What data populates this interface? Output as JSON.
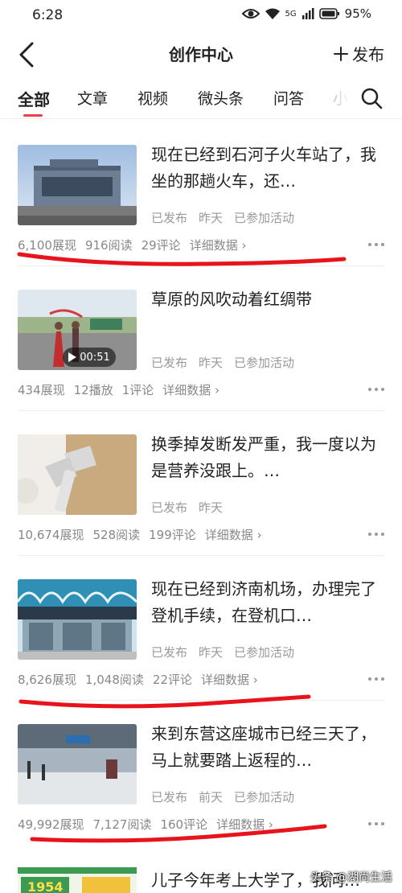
{
  "status_bar": {
    "time": "6:28",
    "signal_label": "5G",
    "battery": "95%"
  },
  "header": {
    "title": "创作中心",
    "publish_label": "发布"
  },
  "tabs": [
    {
      "label": "全部",
      "active": true
    },
    {
      "label": "文章",
      "active": false
    },
    {
      "label": "视频",
      "active": false
    },
    {
      "label": "微头条",
      "active": false
    },
    {
      "label": "问答",
      "active": false
    },
    {
      "label": "小",
      "active": false
    }
  ],
  "items": [
    {
      "title": "现在已经到石河子火车站了，我坐的那趟火车，还…",
      "meta": [
        "已发布",
        "昨天",
        "已参加活动"
      ],
      "stats": [
        "6,100展现",
        "916阅读",
        "29评论"
      ],
      "detail_label": "详细数据",
      "thumb_kind": "station",
      "highlighted": true
    },
    {
      "title": "草原的风吹动着红绸带",
      "meta": [
        "已发布",
        "昨天",
        "已参加活动"
      ],
      "stats": [
        "434展现",
        "12播放",
        "1评论"
      ],
      "detail_label": "详细数据",
      "thumb_kind": "video",
      "video_duration": "00:51",
      "highlighted": false
    },
    {
      "title": "换季掉发断发严重，我一度以为是营养没跟上。…",
      "meta": [
        "已发布",
        "昨天"
      ],
      "stats": [
        "10,674展现",
        "528阅读",
        "199评论"
      ],
      "detail_label": "详细数据",
      "thumb_kind": "dryer",
      "highlighted": false
    },
    {
      "title": "现在已经到济南机场，办理完了登机手续，在登机口…",
      "meta": [
        "已发布",
        "昨天",
        "已参加活动"
      ],
      "stats": [
        "8,626展现",
        "1,048阅读",
        "22评论"
      ],
      "detail_label": "详细数据",
      "thumb_kind": "airport",
      "highlighted": true
    },
    {
      "title": "来到东营这座城市已经三天了，马上就要踏上返程的…",
      "meta": [
        "已发布",
        "前天",
        "已参加活动"
      ],
      "stats": [
        "49,992展现",
        "7,127阅读",
        "160评论"
      ],
      "detail_label": "详细数据",
      "thumb_kind": "hall",
      "highlighted": true
    }
  ],
  "last_item": {
    "title": "儿子今年考上大学了，我问…",
    "thumb_text": "1954"
  },
  "watermark": "头条 @湖尚生活",
  "colors": {
    "accent": "#f04142",
    "annotation_red": "#e8141b",
    "text": "#222222",
    "muted": "#999999"
  },
  "icons": [
    "back-arrow-icon",
    "plus-icon",
    "search-icon",
    "play-icon",
    "more-dots-icon",
    "chevron-right-icon",
    "wifi-icon",
    "eye-icon",
    "battery-icon"
  ]
}
